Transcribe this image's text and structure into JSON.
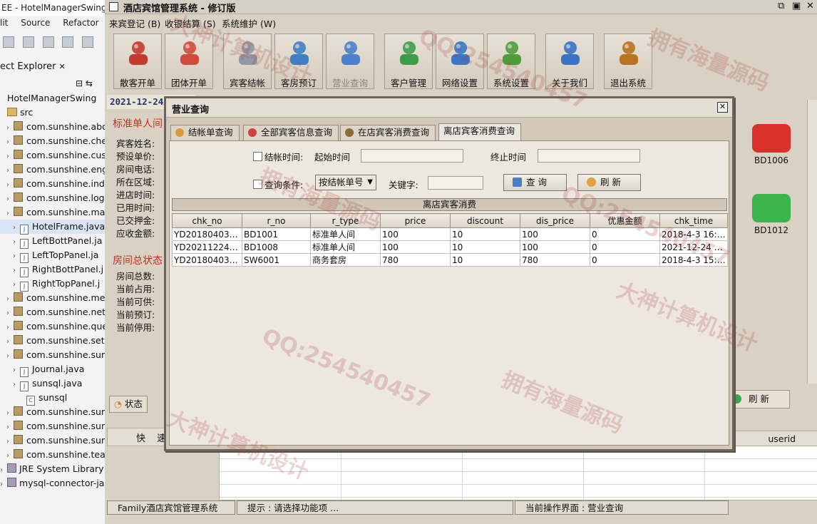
{
  "eclipse": {
    "title": "EE - HotelManagerSwing",
    "menu": [
      "lit",
      "Source",
      "Refactor"
    ],
    "view_title": "ect Explorer",
    "tree": [
      {
        "label": "HotelManagerSwing",
        "kind": "project",
        "indent": 0
      },
      {
        "label": "src",
        "kind": "src",
        "indent": 0
      },
      {
        "label": "com.sunshine.abou",
        "kind": "pkg",
        "indent": 1
      },
      {
        "label": "com.sunshine.chec",
        "kind": "pkg",
        "indent": 1
      },
      {
        "label": "com.sunshine.custo",
        "kind": "pkg",
        "indent": 1
      },
      {
        "label": "com.sunshine.enga",
        "kind": "pkg",
        "indent": 1
      },
      {
        "label": "com.sunshine.indiv",
        "kind": "pkg",
        "indent": 1
      },
      {
        "label": "com.sunshine.login",
        "kind": "pkg",
        "indent": 1
      },
      {
        "label": "com.sunshine.main",
        "kind": "pkg",
        "indent": 1
      },
      {
        "label": "HotelFrame.java",
        "kind": "java",
        "indent": 2,
        "selected": true
      },
      {
        "label": "LeftBottPanel.ja",
        "kind": "java",
        "indent": 2
      },
      {
        "label": "LeftTopPanel.ja",
        "kind": "java",
        "indent": 2
      },
      {
        "label": "RightBottPanel.j",
        "kind": "java",
        "indent": 2
      },
      {
        "label": "RightTopPanel.j",
        "kind": "java",
        "indent": 2
      },
      {
        "label": "com.sunshine.menu",
        "kind": "pkg",
        "indent": 1
      },
      {
        "label": "com.sunshine.netse",
        "kind": "pkg",
        "indent": 1
      },
      {
        "label": "com.sunshine.quer",
        "kind": "pkg",
        "indent": 1
      },
      {
        "label": "com.sunshine.setup",
        "kind": "pkg",
        "indent": 1
      },
      {
        "label": "com.sunshine.suns",
        "kind": "pkg",
        "indent": 1
      },
      {
        "label": "Journal.java",
        "kind": "java",
        "indent": 2
      },
      {
        "label": "sunsql.java",
        "kind": "java",
        "indent": 2
      },
      {
        "label": "sunsql",
        "kind": "class",
        "indent": 3
      },
      {
        "label": "com.sunshine.suns",
        "kind": "pkg",
        "indent": 1
      },
      {
        "label": "com.sunshine.suns",
        "kind": "pkg",
        "indent": 1
      },
      {
        "label": "com.sunshine.suns",
        "kind": "pkg",
        "indent": 1
      },
      {
        "label": "com.sunshine.team",
        "kind": "pkg",
        "indent": 1
      },
      {
        "label": "JRE System Library [jd",
        "kind": "lib",
        "indent": 0
      },
      {
        "label": "mysql-connector-java",
        "kind": "lib",
        "indent": 0
      }
    ]
  },
  "app": {
    "title": "酒店宾馆管理系统 - 修订版",
    "menu": [
      "来宾登记 (B)",
      "收银结算 (S)",
      "系统维护 (W)"
    ],
    "toolbar": [
      {
        "label": "散客开单",
        "icon": "person-icon",
        "color": "#c23b2e"
      },
      {
        "label": "团体开单",
        "icon": "group-icon",
        "color": "#d14a3a"
      },
      {
        "label": "宾客结帐",
        "icon": "robot-icon",
        "color": "#8f9aa6"
      },
      {
        "label": "客房预订",
        "icon": "compass-icon",
        "color": "#3f7fc4"
      },
      {
        "label": "营业查询",
        "icon": "folder-search-icon",
        "color": "#4a80c9",
        "dim": true
      },
      {
        "label": "客户管理",
        "icon": "customer-icon",
        "color": "#3d9c4a"
      },
      {
        "label": "网络设置",
        "icon": "network-icon",
        "color": "#3a78c8"
      },
      {
        "label": "系统设置",
        "icon": "tools-icon",
        "color": "#4f9c38"
      },
      {
        "label": "关于我们",
        "icon": "phone-icon",
        "color": "#3c72c6"
      },
      {
        "label": "退出系统",
        "icon": "exit-icon",
        "color": "#b9721f"
      }
    ],
    "date": "2021-12-24",
    "left_panel": {
      "room_type_heading": "标准单人间",
      "fields": [
        "宾客姓名:",
        "预设单价:",
        "房间电话:",
        "所在区域:",
        "进店时间:",
        "已用时间:",
        "已交押金:",
        "应收金额:"
      ],
      "summary_heading": "房间总状态",
      "summary": [
        "房间总数:",
        "当前占用:",
        "当前可供:",
        "当前预订:",
        "当前停用:"
      ],
      "tab_label": "状态"
    },
    "quick_label": "快 速",
    "rooms": [
      {
        "label": "BD1006",
        "icon": "occupied-room-icon",
        "color": "#d8322a"
      },
      {
        "label": "BD1012",
        "icon": "free-room-icon",
        "color": "#3bb54a"
      }
    ],
    "bg_refresh_label": "刷 新",
    "bg_table_header": "userid",
    "status": [
      "Family酒店宾馆管理系统",
      "提示 : 请选择功能项 ...",
      "当前操作界面 : 营业查询"
    ]
  },
  "dialog": {
    "title": "营业查询",
    "tabs": [
      "结帐单查询",
      "全部宾客信息查询",
      "在店宾客消费查询",
      "离店宾客消费查询"
    ],
    "active_tab": 3,
    "checkout_time_label": "结帐时间:",
    "start_label": "起始时间",
    "end_label": "终止时间",
    "start_value": "",
    "end_value": "",
    "condition_label": "查询条件:",
    "condition_select": "按结帐单号",
    "keyword_label": "关键字:",
    "keyword_value": "",
    "query_button": "查 询",
    "refresh_button": "刷 新",
    "group_title": "离店宾客消费",
    "columns": [
      "chk_no",
      "r_no",
      "r_type",
      "price",
      "discount",
      "dis_price",
      "优惠金额",
      "chk_time"
    ],
    "rows": [
      [
        "YD2018040300...",
        "BD1001",
        "标准单人间",
        "100",
        "10",
        "100",
        "0",
        "2018-4-3 16:33..."
      ],
      [
        "YD2021122400...",
        "BD1008",
        "标准单人间",
        "100",
        "10",
        "100",
        "0",
        "2021-12-24 21:..."
      ],
      [
        "YD2018040300...",
        "SW6001",
        "商务套房",
        "780",
        "10",
        "780",
        "0",
        "2018-4-3 15:40..."
      ]
    ]
  },
  "watermarks": [
    "拥有海量源码",
    "QQ:254540457",
    "大神计算机设计",
    "拥有海量源码",
    "QQ:254540457",
    "大神计算机设计",
    "QQ:254540457",
    "拥有海量源码",
    "大神计算机设计"
  ]
}
